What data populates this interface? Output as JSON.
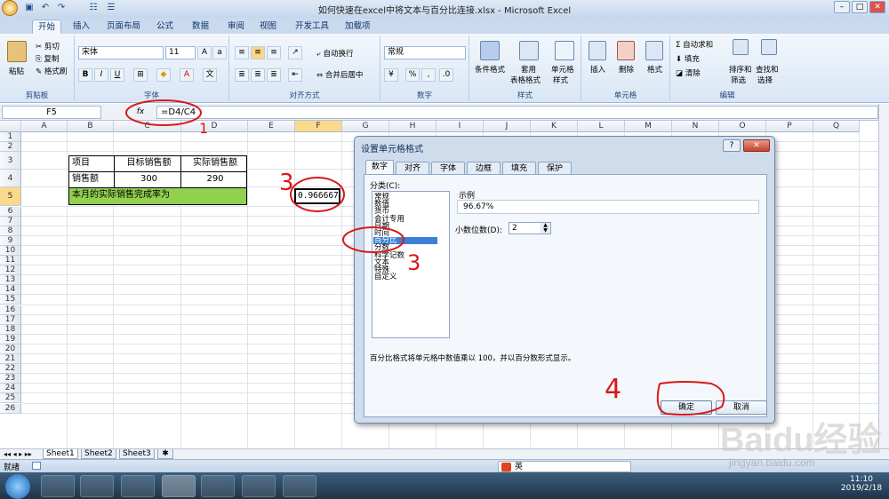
{
  "window": {
    "title": "如何快速在excel中将文本与百分比连接.xlsx - Microsoft Excel",
    "min": "–",
    "max": "□",
    "close": "✕"
  },
  "tabs": [
    "开始",
    "插入",
    "页面布局",
    "公式",
    "数据",
    "审阅",
    "视图",
    "开发工具",
    "加载项"
  ],
  "ribbon": {
    "clipboard": {
      "label": "剪贴板",
      "paste": "粘贴",
      "cut": "剪切",
      "copy": "复制",
      "format_painter": "格式刷"
    },
    "font": {
      "label": "字体",
      "name": "宋体",
      "size": "11",
      "bold": "B",
      "italic": "I",
      "underline": "U"
    },
    "align": {
      "label": "对齐方式",
      "wrap": "自动换行",
      "merge": "合并后居中"
    },
    "number": {
      "label": "数字",
      "format": "常规",
      "percent": "%"
    },
    "styles": {
      "label": "样式",
      "cond": "条件格式",
      "table": "套用",
      "table2": "表格格式",
      "cellstyle": "单元格",
      "cellstyle2": "样式"
    },
    "cells": {
      "label": "单元格",
      "insert": "插入",
      "delete": "删除",
      "format": "格式"
    },
    "edit": {
      "label": "编辑",
      "sum": "Σ 自动求和",
      "fill": "填充",
      "clear": "清除",
      "sort": "排序和",
      "sort2": "筛选",
      "find": "查找和",
      "find2": "选择"
    }
  },
  "formula_bar": {
    "name": "F5",
    "fx": "fx",
    "formula": "=D4/C4"
  },
  "columns": [
    "A",
    "B",
    "C",
    "D",
    "E",
    "F",
    "G",
    "H",
    "I",
    "J",
    "K",
    "L",
    "M",
    "N",
    "O",
    "P",
    "Q"
  ],
  "rows": [
    "1",
    "2",
    "3",
    "4",
    "5",
    "6",
    "7",
    "8",
    "9",
    "10",
    "11",
    "12",
    "13",
    "14",
    "15",
    "16",
    "17",
    "18",
    "19",
    "20",
    "21",
    "22",
    "23",
    "24",
    "25",
    "26"
  ],
  "cells": {
    "b3": "项目",
    "c3": "目标销售额",
    "d3": "实际销售额",
    "b4": "销售额",
    "c4": "300",
    "d4": "290",
    "b5": "本月的实际销售完成率为",
    "f5": "0.966667"
  },
  "sheets": [
    "Sheet1",
    "Sheet2",
    "Sheet3"
  ],
  "status": {
    "ready": "就绪"
  },
  "dialog": {
    "title": "设置单元格格式",
    "help": "?",
    "close": "✕",
    "tabs": [
      "数字",
      "对齐",
      "字体",
      "边框",
      "填充",
      "保护"
    ],
    "category_label": "分类(C):",
    "categories": [
      "常规",
      "数值",
      "货币",
      "会计专用",
      "日期",
      "时间",
      "百分比",
      "分数",
      "科学记数",
      "文本",
      "特殊",
      "自定义"
    ],
    "selected_category": "百分比",
    "sample_label": "示例",
    "sample_value": "96.67%",
    "decimals_label": "小数位数(D):",
    "decimals_value": "2",
    "description": "百分比格式将单元格中数值乘以 100，并以百分数形式显示。",
    "ok": "确定",
    "cancel": "取消"
  },
  "annotations": {
    "n1": "1",
    "n3a": "3",
    "n3b": "3",
    "n4": "4"
  },
  "taskbar": {
    "time": "11:10",
    "date": "2019/2/18",
    "ime": "英"
  },
  "watermark": {
    "brand": "Baidu经验",
    "url": "jingyan.baidu.com"
  }
}
